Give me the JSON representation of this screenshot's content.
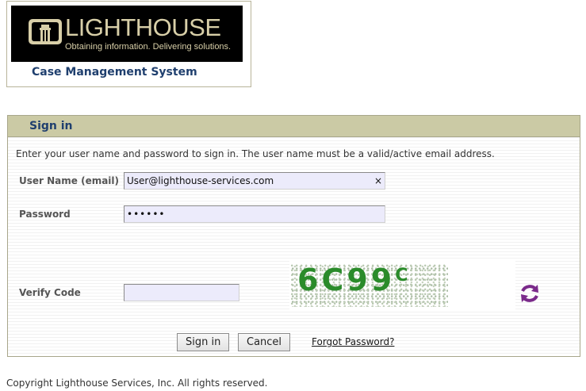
{
  "header": {
    "logo_word": "LIGHTHOUSE",
    "logo_tagline": "Obtaining information. Delivering solutions.",
    "system_title": "Case Management System"
  },
  "signin": {
    "title": "Sign in",
    "instructions": "Enter your user name and password to sign in. The user name must be a valid/active email address.",
    "username_label": "User Name (email)",
    "username_value": "User@lighthouse-services.com",
    "clear_symbol": "×",
    "password_label": "Password",
    "password_value": "••••••",
    "verify_label": "Verify Code",
    "verify_value": "",
    "captcha_main": "6C99",
    "captcha_small": "C",
    "signin_button": "Sign in",
    "cancel_button": "Cancel",
    "forgot_link": "Forgot Password?"
  },
  "footer": {
    "copyright": "Copyright Lighthouse Services, Inc. All rights reserved."
  },
  "colors": {
    "accent": "#1f3f6e",
    "panel_header": "#cbcaa5",
    "input_bg": "#ecebfb",
    "captcha": "#2a8b2a",
    "refresh_icon": "#7a2a8a"
  },
  "icons": {
    "logo_mark": "lighthouse-logo-icon",
    "clear": "clear-x-icon",
    "refresh": "refresh-captcha-icon"
  }
}
